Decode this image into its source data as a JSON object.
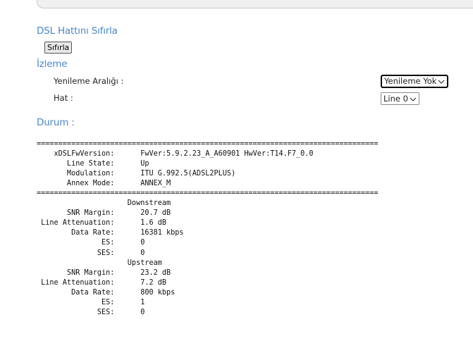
{
  "sections": {
    "reset_title": "DSL Hattını Sıfırla",
    "monitor_title": "İzleme",
    "status_title": "Durum :"
  },
  "reset": {
    "button_label": "Sıfırla"
  },
  "monitor": {
    "refresh_label": "Yenileme Aralığı :",
    "refresh_value": "Yenileme Yok",
    "line_label": "Hat :",
    "line_value": "Line 0"
  },
  "status": {
    "text": "===============================================================================\n    xDSLFwVersion:      FwVer:5.9.2.23_A_A60901 HwVer:T14.F7_0.0\n       Line State:      Up\n       Modulation:      ITU G.992.5(ADSL2PLUS)\n       Annex Mode:      ANNEX_M\n===============================================================================\n                     Downstream\n       SNR Margin:      20.7 dB\n Line Attenuation:      1.6 dB\n        Data Rate:      16381 kbps\n               ES:      0\n              SES:      0\n                     Upstream\n       SNR Margin:      23.2 dB\n Line Attenuation:      7.2 dB\n        Data Rate:      800 kbps\n               ES:      1\n              SES:      0"
  },
  "colors": {
    "section_title": "#4a86c8"
  }
}
